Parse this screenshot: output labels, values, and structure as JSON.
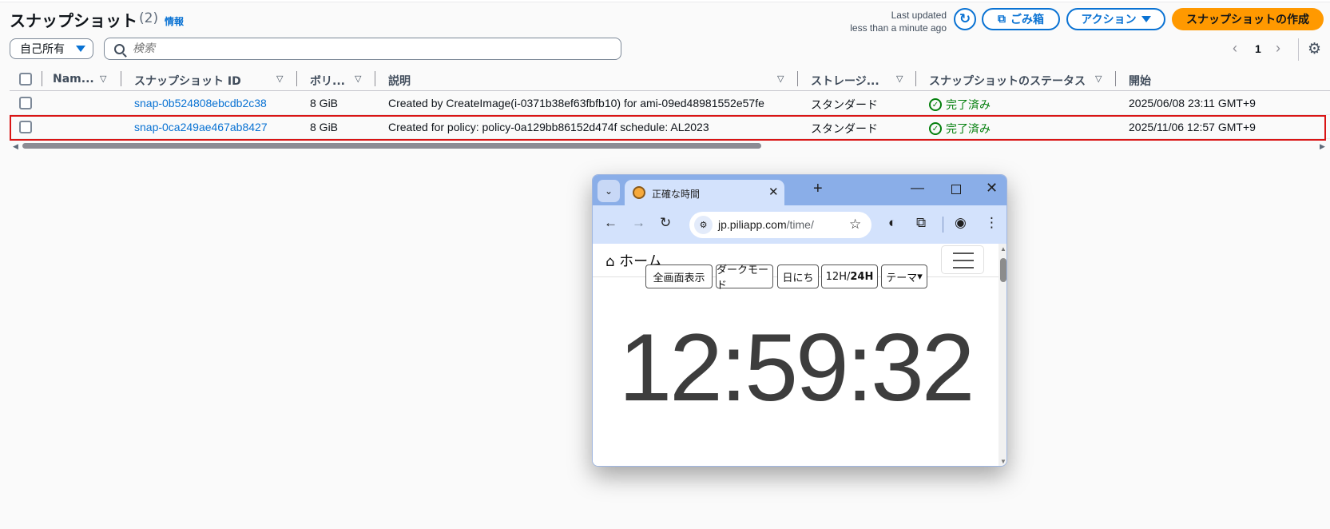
{
  "header": {
    "title": "スナップショット",
    "count": "(2)",
    "info_link": "情報",
    "last_updated_line1": "Last updated",
    "last_updated_line2": "less than a minute ago",
    "refresh_icon": "refresh-icon",
    "trash_button": "ごみ箱",
    "actions_button": "アクション",
    "create_button": "スナップショットの作成"
  },
  "filters": {
    "owner_select": "自己所有",
    "search_placeholder": "検索"
  },
  "pagination": {
    "prev": "‹",
    "page": "1",
    "next": "›"
  },
  "table": {
    "columns": [
      "Nam...",
      "スナップショット ID",
      "ボリ...",
      "説明",
      "ストレージ...",
      "スナップショットのステータス",
      "開始"
    ],
    "rows": [
      {
        "id": "snap-0b524808ebcdb2c38",
        "volume": "8 GiB",
        "description": "Created by CreateImage(i-0371b38ef63fbfb10) for ami-09ed48981552e57fe",
        "storage": "スタンダード",
        "status": "完了済み",
        "started": "2025/06/08 23:11 GMT+9"
      },
      {
        "id": "snap-0ca249ae467ab8427",
        "volume": "8 GiB",
        "description": "Created for policy: policy-0a129bb86152d474f schedule: AL2023",
        "storage": "スタンダード",
        "status": "完了済み",
        "started": "2025/11/06 12:57 GMT+9"
      }
    ]
  },
  "browser": {
    "tab_title": "正確な時間",
    "url_host": "jp.piliapp.com",
    "url_path": "/time/",
    "page": {
      "home": "ホーム",
      "buttons": [
        "全画面表示",
        "ダークモード",
        "日にち",
        "12H/",
        "24H",
        "テーマ"
      ],
      "time": "12:59:32"
    }
  },
  "colors": {
    "link": "#0972d3",
    "primary_button": "#ff9900",
    "success": "#037f0c",
    "selection_frame": "#d91515"
  }
}
